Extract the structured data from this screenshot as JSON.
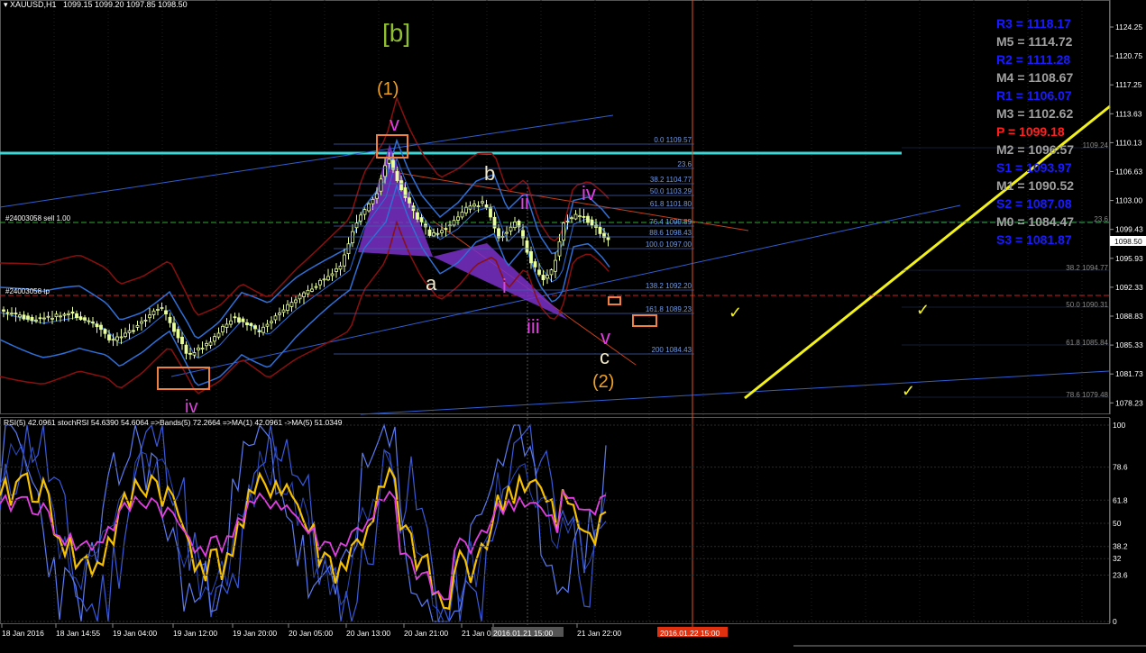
{
  "header": {
    "symbol": "XAUUSD,H1",
    "ohlc": "1099.15 1099.20 1097.85 1098.50"
  },
  "colors": {
    "background": "#000000",
    "candle_up": "#e8ff9a",
    "candle_down": "#e8ff9a",
    "bollinger_blue": "#2f6fd6",
    "bollinger_red": "#8b0f0f",
    "resistance_cyan": "#3fd6d6",
    "trend_yellow": "#f2f21a",
    "wave_magenta": "#e040e0",
    "wave_orange": "#f0a020",
    "box_orange": "#f08040",
    "pivot_blue": "#1a1aff",
    "pivot_gray": "#a0a0a0",
    "pivot_red": "#ff2020",
    "rsi_yellow": "#f5c000",
    "rsi_magenta": "#e040e0",
    "grid": "#2a2a2a"
  },
  "wave_labels": {
    "bracket_b": "[b]",
    "one": "(1)",
    "two": "(2)",
    "v_top": "v",
    "a": "a",
    "b": "b",
    "c": "c",
    "i": "i",
    "ii": "ii",
    "iii": "iii",
    "iv_top": "iv",
    "v_bottom": "v",
    "iv_bottom": "iv"
  },
  "order_labels": {
    "sell": "#24003058 sell 1.00",
    "tp": "#24003058 tp"
  },
  "fib_labels": [
    "0.0 1109.57",
    "23.6",
    "38.2 1104.77",
    "50.0 1103.29",
    "61.8 1101.80",
    "76.4 1099.89",
    "88.6 1098.43",
    "100.0 1097.00",
    "138.2 1092.20",
    "161.8 1089.23",
    "200 1084.43"
  ],
  "fib2_labels": [
    "1109.24",
    "23.6",
    "38.2 1094.77",
    "50.0 1090.31",
    "61.8 1085.84",
    "78.6 1079.48"
  ],
  "pivots": [
    {
      "label": "R3",
      "value": "= 1118.17",
      "kind": "r"
    },
    {
      "label": "M5",
      "value": "= 1114.72",
      "kind": "m"
    },
    {
      "label": "R2",
      "value": "= 1111.28",
      "kind": "r"
    },
    {
      "label": "M4",
      "value": "= 1108.67",
      "kind": "m"
    },
    {
      "label": "R1",
      "value": "= 1106.07",
      "kind": "r"
    },
    {
      "label": "M3",
      "value": "= 1102.62",
      "kind": "m"
    },
    {
      "label": "P",
      "value": "= 1099.18",
      "kind": "p"
    },
    {
      "label": "M2",
      "value": "= 1096.57",
      "kind": "m"
    },
    {
      "label": "S1",
      "value": "= 1093.97",
      "kind": "r"
    },
    {
      "label": "M1",
      "value": "= 1090.52",
      "kind": "m"
    },
    {
      "label": "S2",
      "value": "= 1087.08",
      "kind": "r"
    },
    {
      "label": "M0",
      "value": "= 1084.47",
      "kind": "m"
    },
    {
      "label": "S3",
      "value": "= 1081.87",
      "kind": "r"
    }
  ],
  "price_axis": {
    "ticks": [
      "1124.25",
      "1120.75",
      "1117.25",
      "1113.63",
      "1110.13",
      "1106.63",
      "1103.00",
      "1099.43",
      "1095.93",
      "1092.33",
      "1088.83",
      "1085.33",
      "1081.73",
      "1078.23"
    ],
    "current_price": "1098.50"
  },
  "rsi_panel": {
    "header": "RSI(5) 42.0961  stochRSI 54.6390 54.6064  =>Bands(5) 72.2664  =>MA(1) 42.0961  ->MA(5) 51.0349",
    "ticks": [
      "100",
      "78.6",
      "61.8",
      "50",
      "38.2",
      "32",
      "23.6",
      "0"
    ]
  },
  "time_axis": {
    "labels": [
      "18 Jan 2016",
      "18 Jan 14:55",
      "19 Jan 04:00",
      "19 Jan 12:00",
      "19 Jan 20:00",
      "20 Jan 05:00",
      "20 Jan 13:00",
      "20 Jan 21:00",
      "21 Jan 0",
      "2016.01.21 15:00",
      "21 Jan 22:00"
    ],
    "cursor_label": "2016.01.22 15:00"
  },
  "checkmark": "✓"
}
